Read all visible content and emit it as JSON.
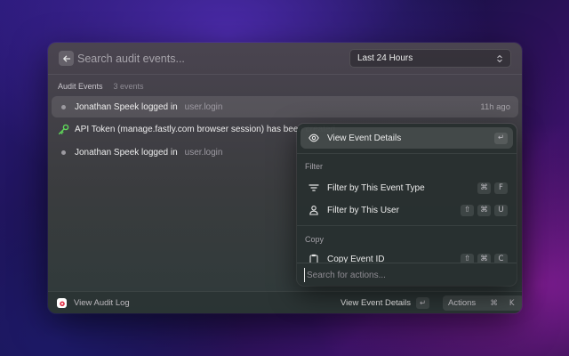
{
  "search": {
    "placeholder": "Search audit events..."
  },
  "time_range": {
    "selected": "Last 24 Hours"
  },
  "section": {
    "title": "Audit Events",
    "count": "3 events"
  },
  "events": [
    {
      "title": "Jonathan Speek logged in",
      "type": "user.login",
      "time": "11h ago",
      "icon": "dot-icon"
    },
    {
      "title": "API Token (manage.fastly.com browser session) has been created",
      "type": "",
      "time": "",
      "icon": "key-icon"
    },
    {
      "title": "Jonathan Speek logged in",
      "type": "user.login",
      "time": "",
      "icon": "dot-icon"
    }
  ],
  "action_panel": {
    "primary": {
      "label": "View Event Details",
      "icon": "eye-icon",
      "keys": [
        "↵"
      ]
    },
    "sections": [
      {
        "title": "Filter",
        "items": [
          {
            "label": "Filter by This Event Type",
            "icon": "filter-icon",
            "keys": [
              "⌘",
              "F"
            ]
          },
          {
            "label": "Filter by This User",
            "icon": "user-icon",
            "keys": [
              "⇧",
              "⌘",
              "U"
            ]
          }
        ]
      },
      {
        "title": "Copy",
        "items": [
          {
            "label": "Copy Event ID",
            "icon": "clipboard-icon",
            "keys": [
              "⇧",
              "⌘",
              "C"
            ]
          }
        ]
      }
    ],
    "search_placeholder": "Search for actions..."
  },
  "footer": {
    "label": "View Audit Log",
    "primary_action": "View Event Details",
    "primary_key": "↵",
    "actions_label": "Actions",
    "actions_keys": [
      "⌘",
      "K"
    ]
  },
  "colors": {
    "accent_key": "#5fd65a",
    "logo": "#e0344a"
  }
}
